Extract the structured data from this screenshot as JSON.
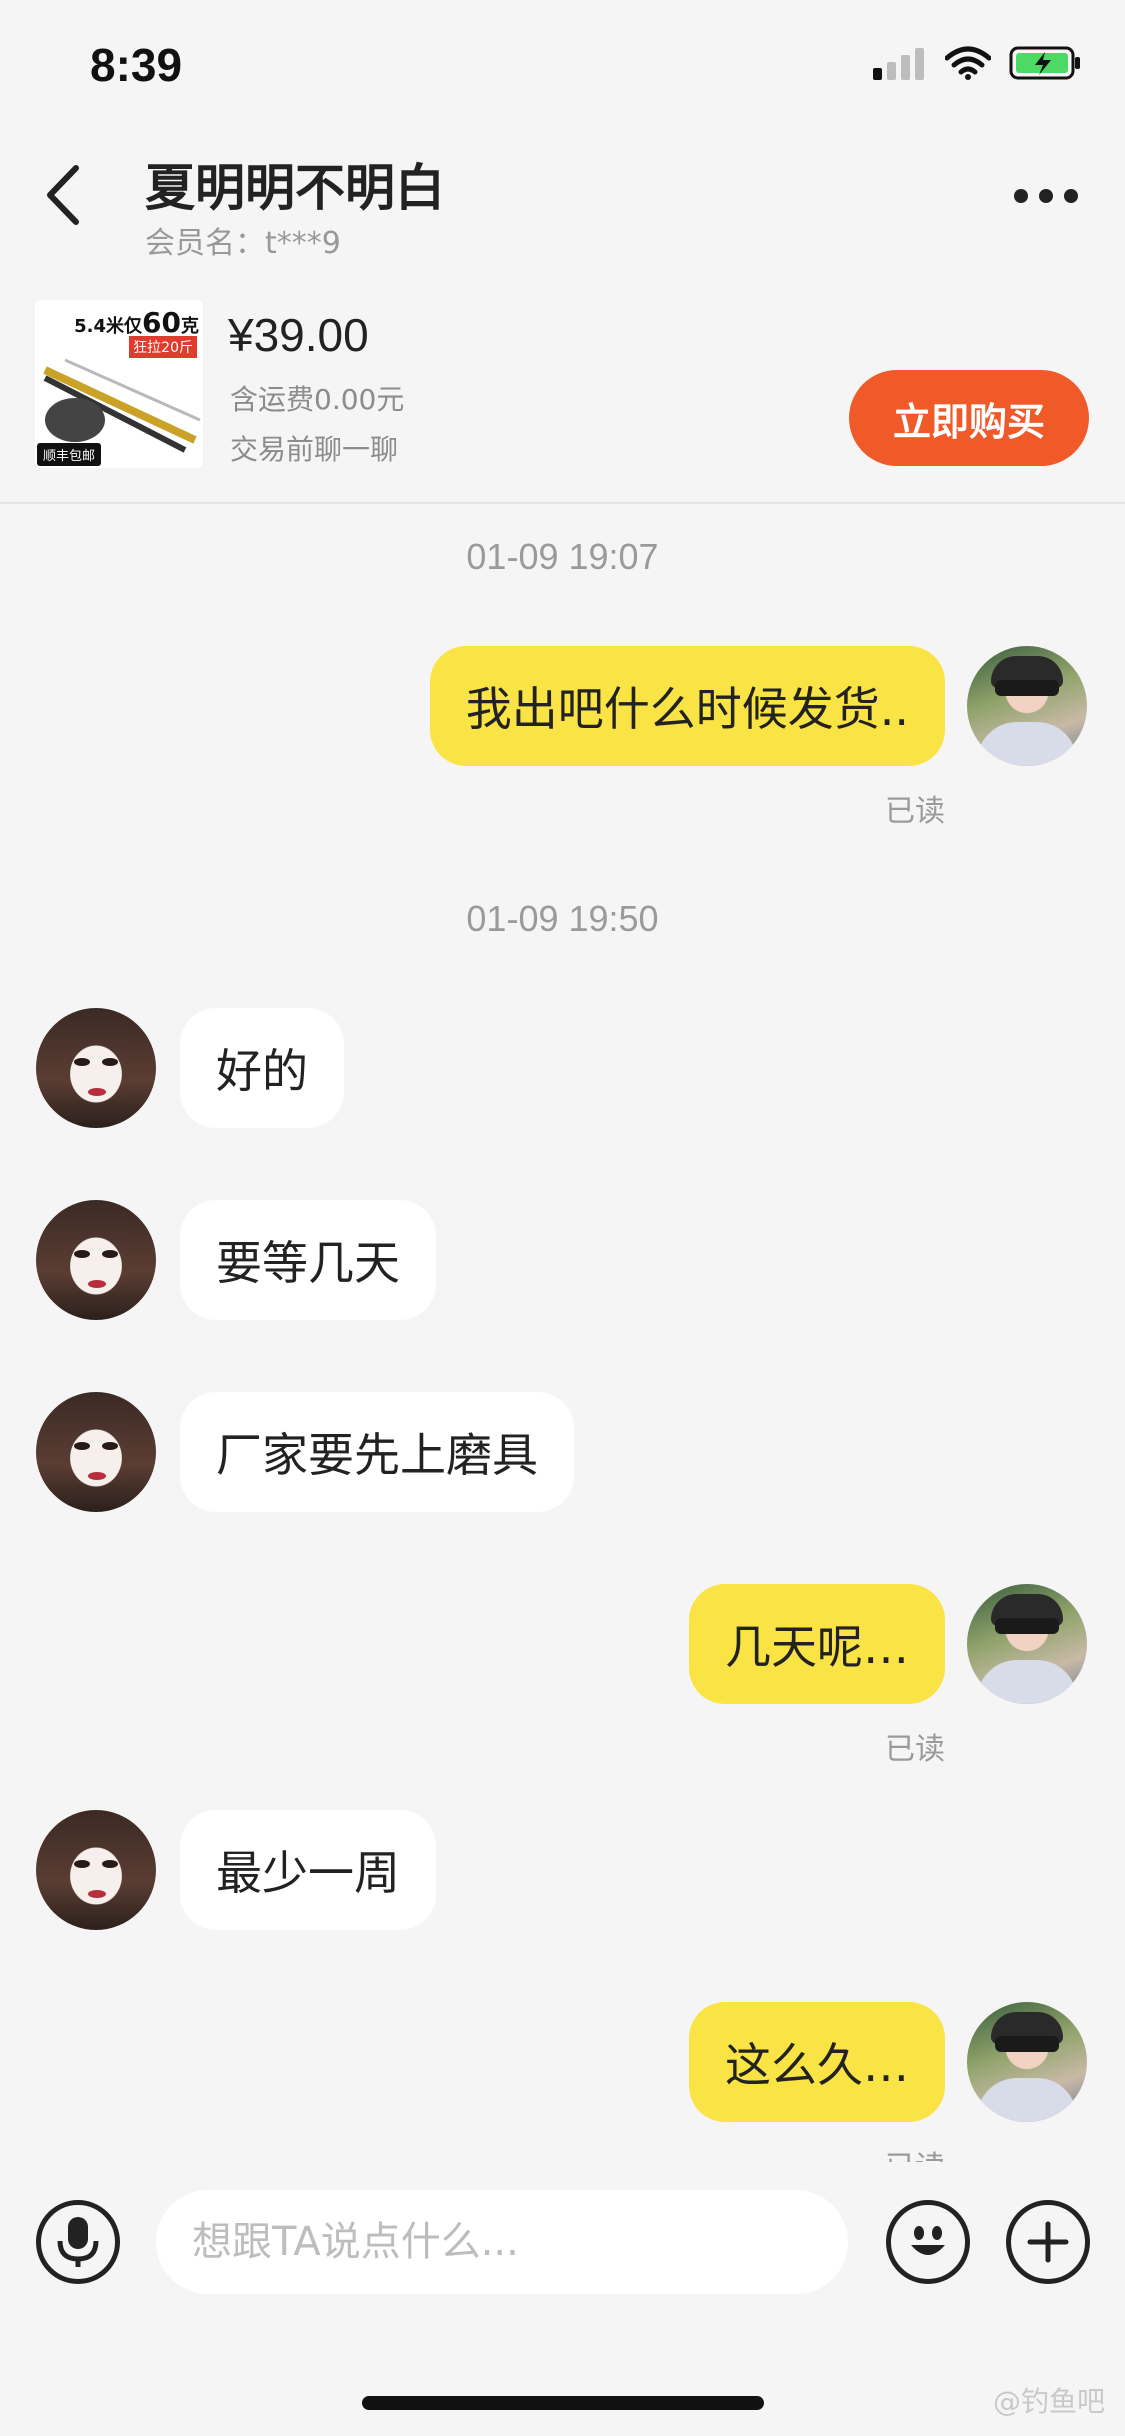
{
  "status_bar": {
    "time": "8:39",
    "icons": [
      "signal-icon",
      "wifi-icon",
      "battery-charging-icon"
    ]
  },
  "header": {
    "title": "夏明明不明白",
    "subtitle": "会员名：t***9"
  },
  "product": {
    "thumb_tag_prefix": "5.4米仅",
    "thumb_tag_number": "60",
    "thumb_tag_suffix": "克",
    "thumb_badge": "狂拉20斤",
    "thumb_shipping_badge": "顺丰包邮",
    "price": "¥39.00",
    "shipping": "含运费0.00元",
    "chat_hint": "交易前聊一聊",
    "buy_label": "立即购买"
  },
  "messages": {
    "ts1": "01-09 19:07",
    "ts2": "01-09 19:50",
    "m1": "我出吧什么时候发货..",
    "m2": "好的",
    "m3": "要等几天",
    "m4": "厂家要先上磨具",
    "m5": "几天呢…",
    "m6": "最少一周",
    "m7": "这么久…",
    "read": "已读"
  },
  "input": {
    "placeholder": "想跟TA说点什么..."
  },
  "watermark": "@钓鱼吧",
  "colors": {
    "my_bubble": "#fae344",
    "buy_button": "#f05a28",
    "background": "#f5f5f5"
  }
}
